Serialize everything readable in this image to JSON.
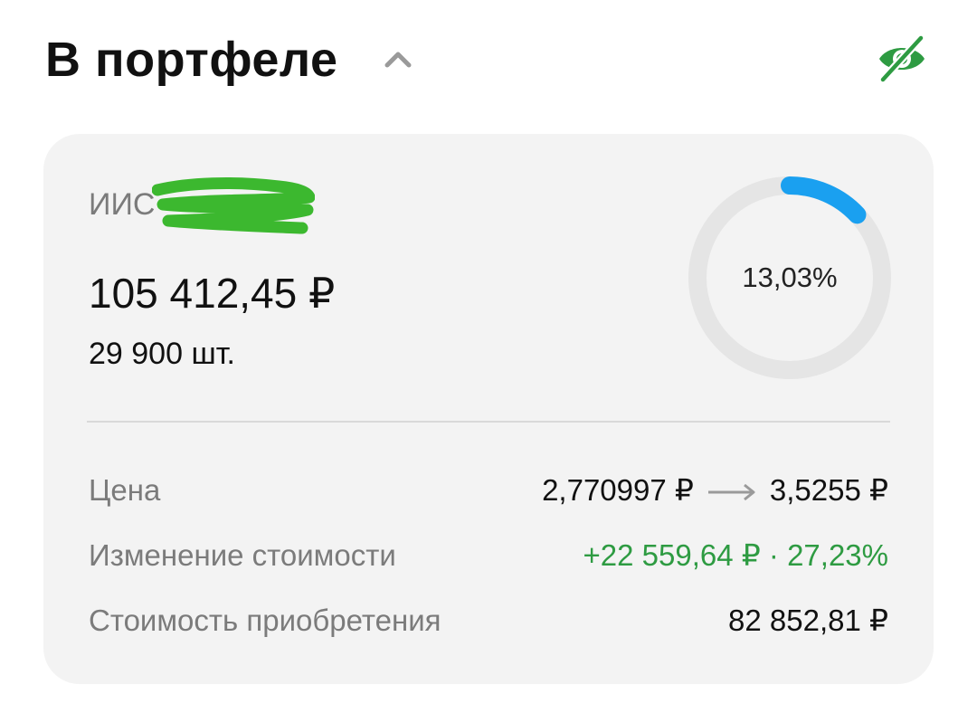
{
  "header": {
    "title": "В портфеле",
    "collapse_icon": "chevron-up-icon",
    "visibility_icon": "eye-off-icon",
    "accent_color": "#2e9b42"
  },
  "position": {
    "account_name": "ИИС",
    "amount": "105 412,45 ₽",
    "quantity": "29 900 шт.",
    "share_label": "13,03%",
    "share_fraction": 0.1303,
    "ring_color": "#1aa0f0",
    "ring_track_color": "#e5e5e5"
  },
  "details": {
    "price": {
      "label": "Цена",
      "from": "2,770997 ₽",
      "to": "3,5255 ₽"
    },
    "value_change": {
      "label": "Изменение стоимости",
      "value": "+22 559,64 ₽ · 27,23%",
      "color": "#2e9b42"
    },
    "purchase_cost": {
      "label": "Стоимость приобретения",
      "value": "82 852,81 ₽"
    }
  }
}
